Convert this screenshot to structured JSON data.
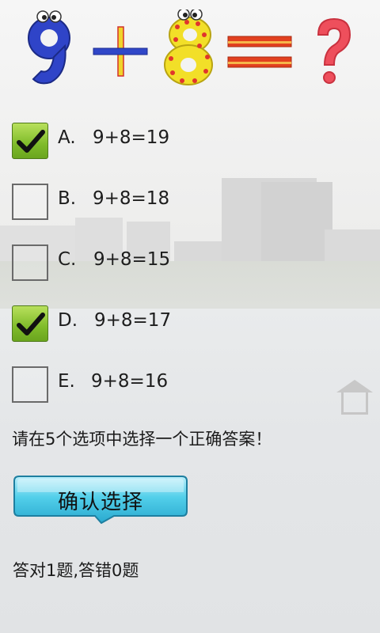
{
  "equation": {
    "operand_a": "9",
    "operator": "+",
    "operand_b": "8",
    "equals": "=",
    "unknown": "?"
  },
  "options": [
    {
      "letter": "A.",
      "text": "9+8=19",
      "checked": true
    },
    {
      "letter": "B.",
      "text": "9+8=18",
      "checked": false
    },
    {
      "letter": "C.",
      "text": "9+8=15",
      "checked": false
    },
    {
      "letter": "D.",
      "text": "9+8=17",
      "checked": true
    },
    {
      "letter": "E.",
      "text": "9+8=16",
      "checked": false
    }
  ],
  "prompt": "请在5个选项中选择一个正确答案！",
  "confirm_button": "确认选择",
  "score": "答对1题,答错0题",
  "colors": {
    "check_green": "#7fbb2a",
    "button_cyan": "#3ec7e6",
    "nine_blue": "#3045c9",
    "eight_yellow": "#f2df28",
    "equals_red": "#e2401f",
    "question_red": "#ee4f5c"
  }
}
